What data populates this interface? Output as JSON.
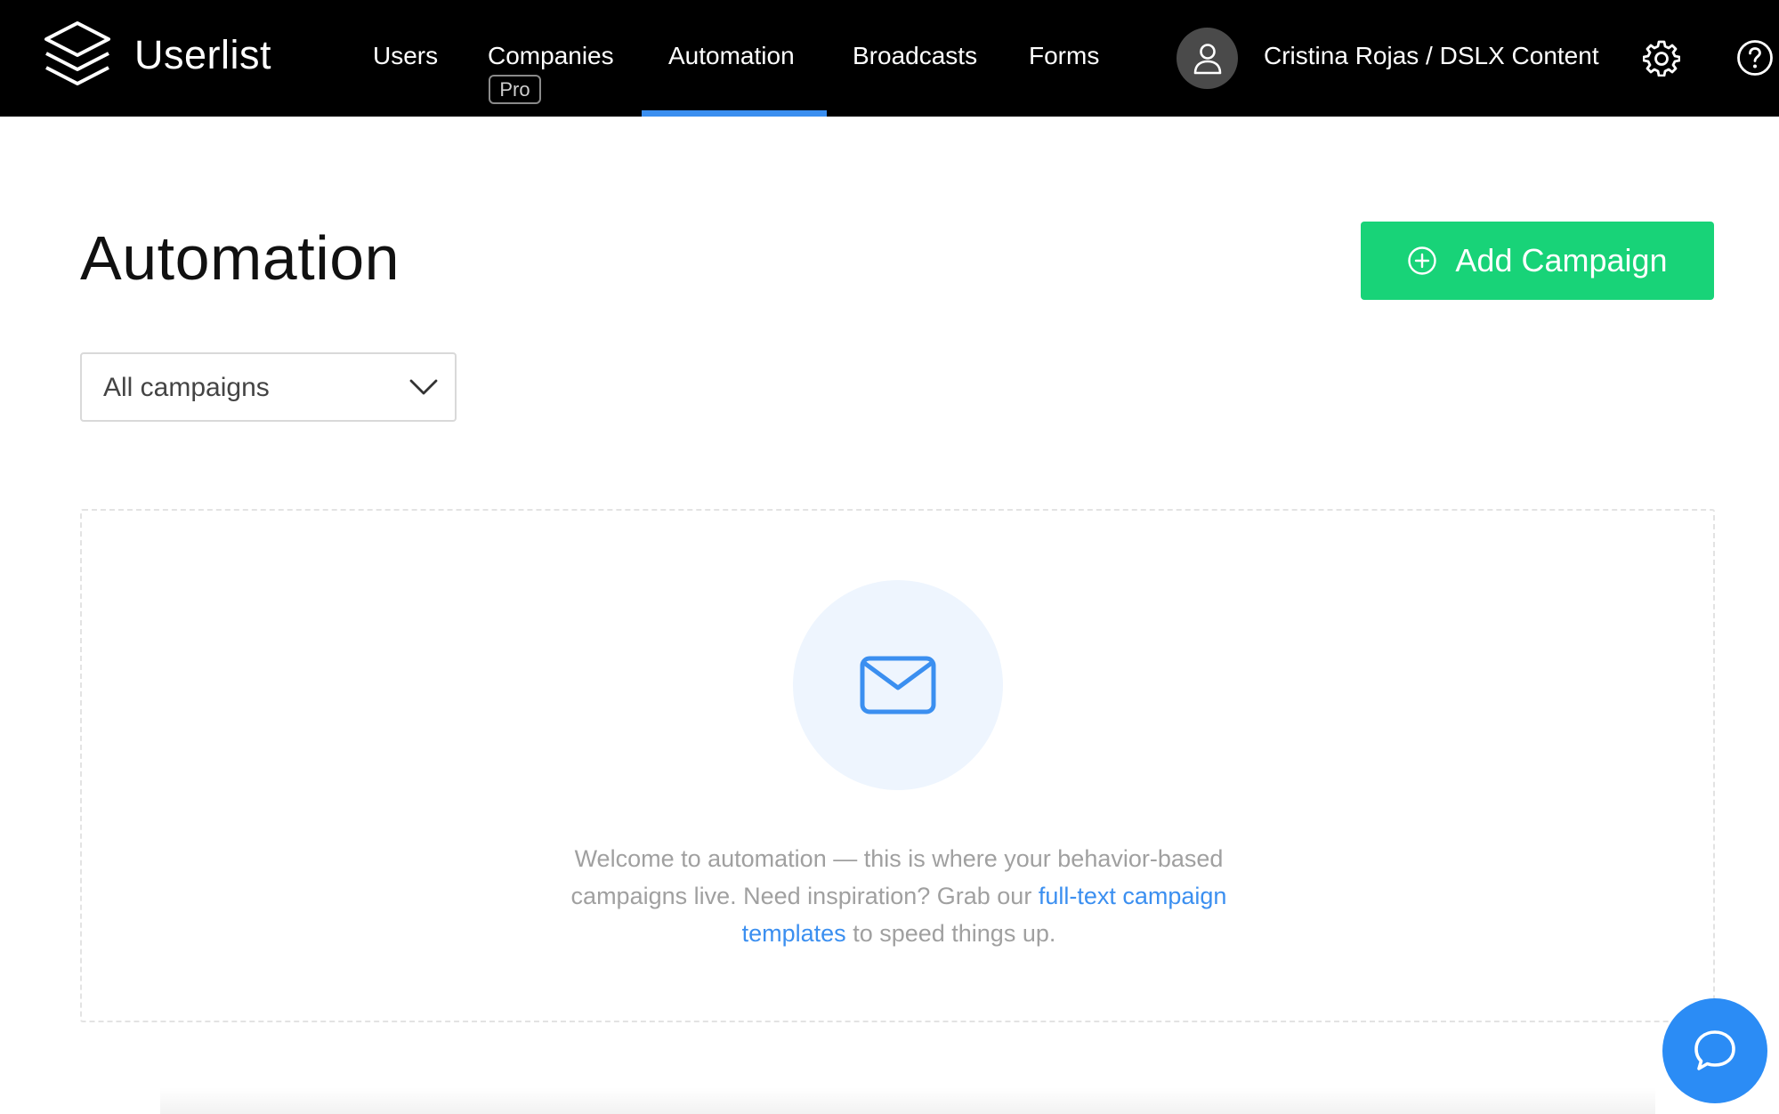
{
  "app": {
    "brand": "Userlist"
  },
  "nav": {
    "items": [
      {
        "label": "Users"
      },
      {
        "label": "Companies",
        "badge": "Pro"
      },
      {
        "label": "Automation",
        "active": true
      },
      {
        "label": "Broadcasts"
      },
      {
        "label": "Forms"
      }
    ],
    "account_name": "Cristina Rojas / DSLX Content",
    "icons": {
      "avatar": "user-icon",
      "settings": "gear-icon",
      "help": "question-circle-icon"
    }
  },
  "page": {
    "title": "Automation",
    "add_button_label": "Add Campaign",
    "filter_selected": "All campaigns"
  },
  "empty_state": {
    "icon": "mail-icon",
    "text_before": "Welcome to automation — this is where your behavior-based campaigns live. Need inspiration? Grab our ",
    "link_text": "full-text campaign templates",
    "text_after": " to speed things up."
  },
  "colors": {
    "accent_blue": "#3b8ff0",
    "button_green": "#18d378",
    "topbar": "#000000",
    "chat_blue": "#2b8cf5"
  }
}
